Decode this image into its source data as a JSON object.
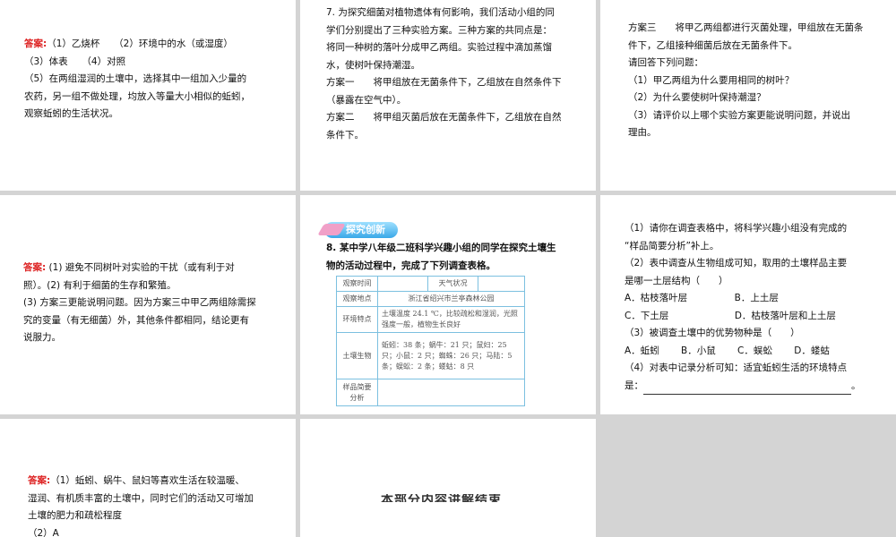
{
  "slides": [
    {
      "answer_label": "答案:",
      "lines": [
        "（1）乙烧杯　　（2）环境中的水（或湿度）",
        "（3）体表　　（4）对照",
        "（5）在两组湿润的土壤中，选择其中一组加入少量的",
        "农药，另一组不做处理，均放入等量大小相似的蚯蚓，",
        "观察蚯蚓的生活状况。"
      ]
    },
    {
      "lines": [
        "7. 为探究细菌对植物遗体有何影响，我们活动小组的同",
        "学们分别提出了三种实验方案。三种方案的共同点是：",
        "将同一种树的落叶分成甲乙两组。实验过程中滴加蒸馏",
        "水，使树叶保持潮湿。",
        "方案一　　将甲组放在无菌条件下，乙组放在自然条件下",
        "（暴露在空气中）。",
        "方案二　　将甲组灭菌后放在无菌条件下，乙组放在自然",
        "条件下。"
      ]
    },
    {
      "lines": [
        "方案三　　将甲乙两组都进行灭菌处理，甲组放在无菌条",
        "件下，乙组接种细菌后放在无菌条件下。",
        "请回答下列问题：",
        "（1）甲乙两组为什么要用相同的树叶？",
        "（2）为什么要使树叶保持潮湿？",
        "（3）请评价以上哪个实验方案更能说明问题，并说出",
        "理由。"
      ]
    },
    {
      "answer_label": "答案:",
      "lines": [
        "(1) 避免不同树叶对实验的干扰（或有利于对",
        "照）。(2) 有利于细菌的生存和繁殖。",
        "(3) 方案三更能说明问题。因为方案三中甲乙两组除需探",
        "究的变量（有无细菌）外，其他条件都相同，结论更有",
        "说服力。"
      ]
    },
    {
      "badge": "探究创新",
      "lines": [
        "8. 某中学八年级二班科学兴趣小组的同学在探究土壤生",
        "物的活动过程中，完成了下列调查表格。"
      ],
      "table": {
        "r0": [
          "观察时间",
          "",
          "天气状况",
          ""
        ],
        "r1": [
          "观察地点",
          "浙江省绍兴市兰亭森林公园"
        ],
        "r2": [
          "环境特点",
          "土壤温度 24.1 ℃，比较疏松和湿润，光照强度一般，植物生长良好"
        ],
        "r3": [
          "土壤生物",
          "蚯蚓：38 条；蜗牛：21 只；鼠妇：25 只；小鼠：2 只；蜘蛛：26 只；马陆：5 条；蜈蚣：2 条；蝼蛄：8 只"
        ],
        "r4": [
          "样品简要分析",
          ""
        ]
      }
    },
    {
      "lines": [
        "（1）请你在调查表格中，将科学兴趣小组没有完成的",
        "“样品简要分析”补上。",
        "（2）表中调查从生物组成可知，取用的土壤样品主要",
        "是哪一土层结构（　　）",
        "A．枯枝落叶层　　　　　B．上土层",
        "C．下土层　　　　　　　D．枯枝落叶层和上土层",
        "（3）被调查土壤中的优势物种是（　　）",
        "A．蚯蚓　　 B．小鼠　　 C．蜈蚣　　 D．蝼蛄",
        "（4）对表中记录分析可知：适宜蚯蚓生活的环境特点"
      ],
      "last_prefix": "是：",
      "last_suffix": "。"
    },
    {
      "answer_label": "答案:",
      "lines": [
        "（1）蚯蚓、蜗牛、鼠妇等喜欢生活在较温暖、",
        "湿润、有机质丰富的土壤中，同时它们的活动又可增加",
        "土壤的肥力和疏松程度",
        "（2）A"
      ]
    },
    {
      "title": "本部分内容讲解结束"
    }
  ]
}
